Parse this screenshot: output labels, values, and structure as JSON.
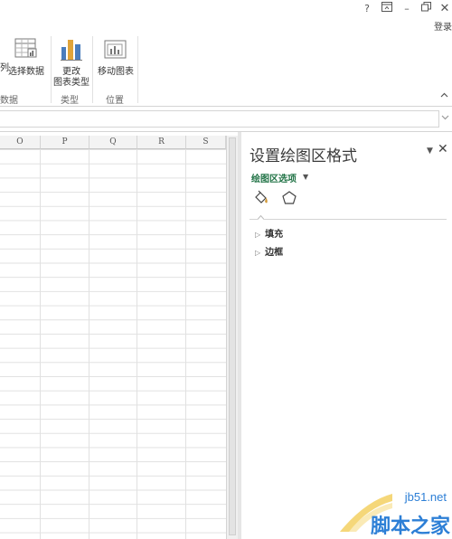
{
  "titlebar": {
    "help_label": "?",
    "restore_ribbon_label": "⊼",
    "minimize_label": "–",
    "maximize_label": "□",
    "login_label": "登录"
  },
  "ribbon": {
    "partial_left_label": "列",
    "select_data_label": "选择数据",
    "change_type_line1": "更改",
    "change_type_line2": "图表类型",
    "move_chart_label": "移动图表",
    "group_data_partial": "数据",
    "group_type": "类型",
    "group_location": "位置",
    "collapse_label": "^"
  },
  "formula": {
    "expand_label": "⌄"
  },
  "grid": {
    "columns": [
      "O",
      "P",
      "Q",
      "R",
      "S"
    ]
  },
  "pane": {
    "title": "设置绘图区格式",
    "options_label": "绘图区选项",
    "options_arrow": "▼",
    "close_label": "✕",
    "pin_label": "▼",
    "sections": [
      {
        "label": "填充",
        "arrow": "▷"
      },
      {
        "label": "边框",
        "arrow": "▷"
      }
    ]
  },
  "watermark": {
    "url": "jb51.net",
    "name": "脚本之家"
  },
  "colors": {
    "accent_green": "#217346",
    "watermark_blue": "#2d7fd6"
  }
}
